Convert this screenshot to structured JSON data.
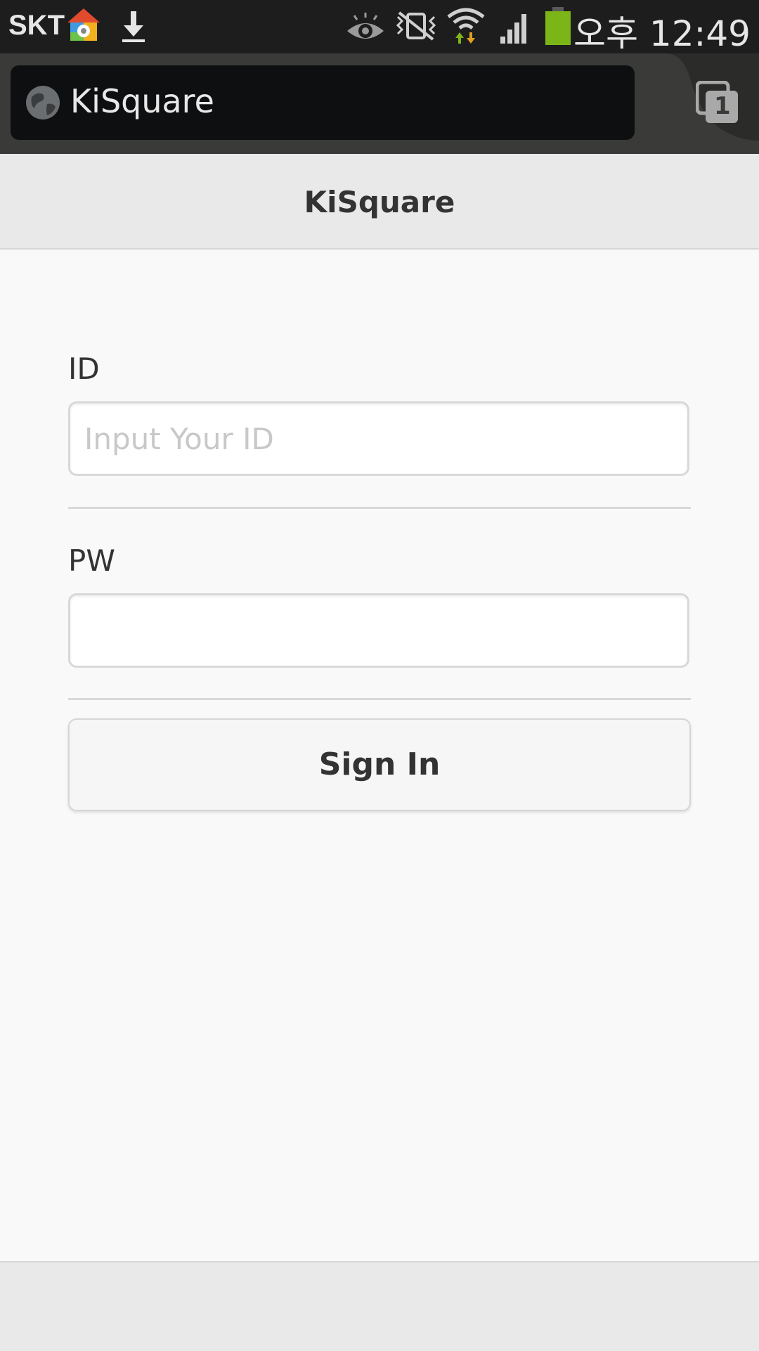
{
  "status_bar": {
    "carrier": "SKT",
    "clock": "오후 12:49",
    "icons": [
      "home-settings-icon",
      "download-icon",
      "eye-icon",
      "vibrate-icon",
      "wifi-icon",
      "signal-icon",
      "battery-icon"
    ],
    "colors": {
      "background": "#1d1d1d",
      "battery": "#7cb518"
    }
  },
  "browser": {
    "url_text": "KiSquare",
    "tab_count": "1"
  },
  "page": {
    "title": "KiSquare"
  },
  "form": {
    "id_label": "ID",
    "id_placeholder": "Input Your ID",
    "id_value": "",
    "pw_label": "PW",
    "pw_value": "",
    "signin_label": "Sign In"
  }
}
